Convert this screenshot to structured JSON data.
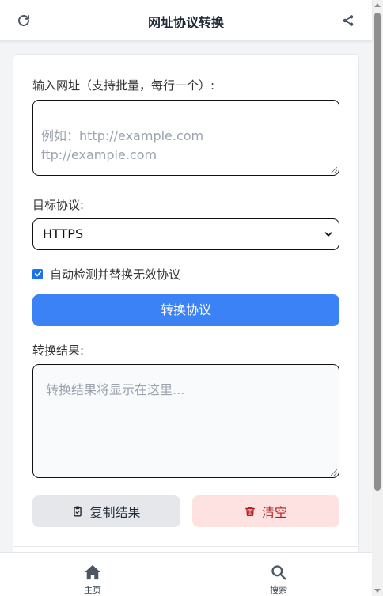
{
  "header": {
    "title": "网址协议转换",
    "left_icon": "refresh-icon",
    "right_icon": "share-icon"
  },
  "form": {
    "url_label": "输入网址（支持批量，每行一个）:",
    "url_placeholder": "例如：http://example.com\nftp://example.com",
    "protocol_label": "目标协议:",
    "protocol_selected": "HTTPS",
    "auto_detect_label": "自动检测并替换无效协议",
    "auto_detect_checked": true,
    "convert_button": "转换协议",
    "result_label": "转换结果:",
    "result_placeholder": "转换结果将显示在这里...",
    "copy_button": "复制结果",
    "clear_button": "清空"
  },
  "bottom_nav": {
    "items": [
      {
        "label": "主页",
        "icon": "home-icon"
      },
      {
        "label": "搜索",
        "icon": "search-icon"
      }
    ]
  },
  "colors": {
    "primary": "#3b82f6",
    "danger_bg": "#fee2e2",
    "danger_text": "#b91c1c",
    "neutral_btn": "#e5e7eb"
  }
}
